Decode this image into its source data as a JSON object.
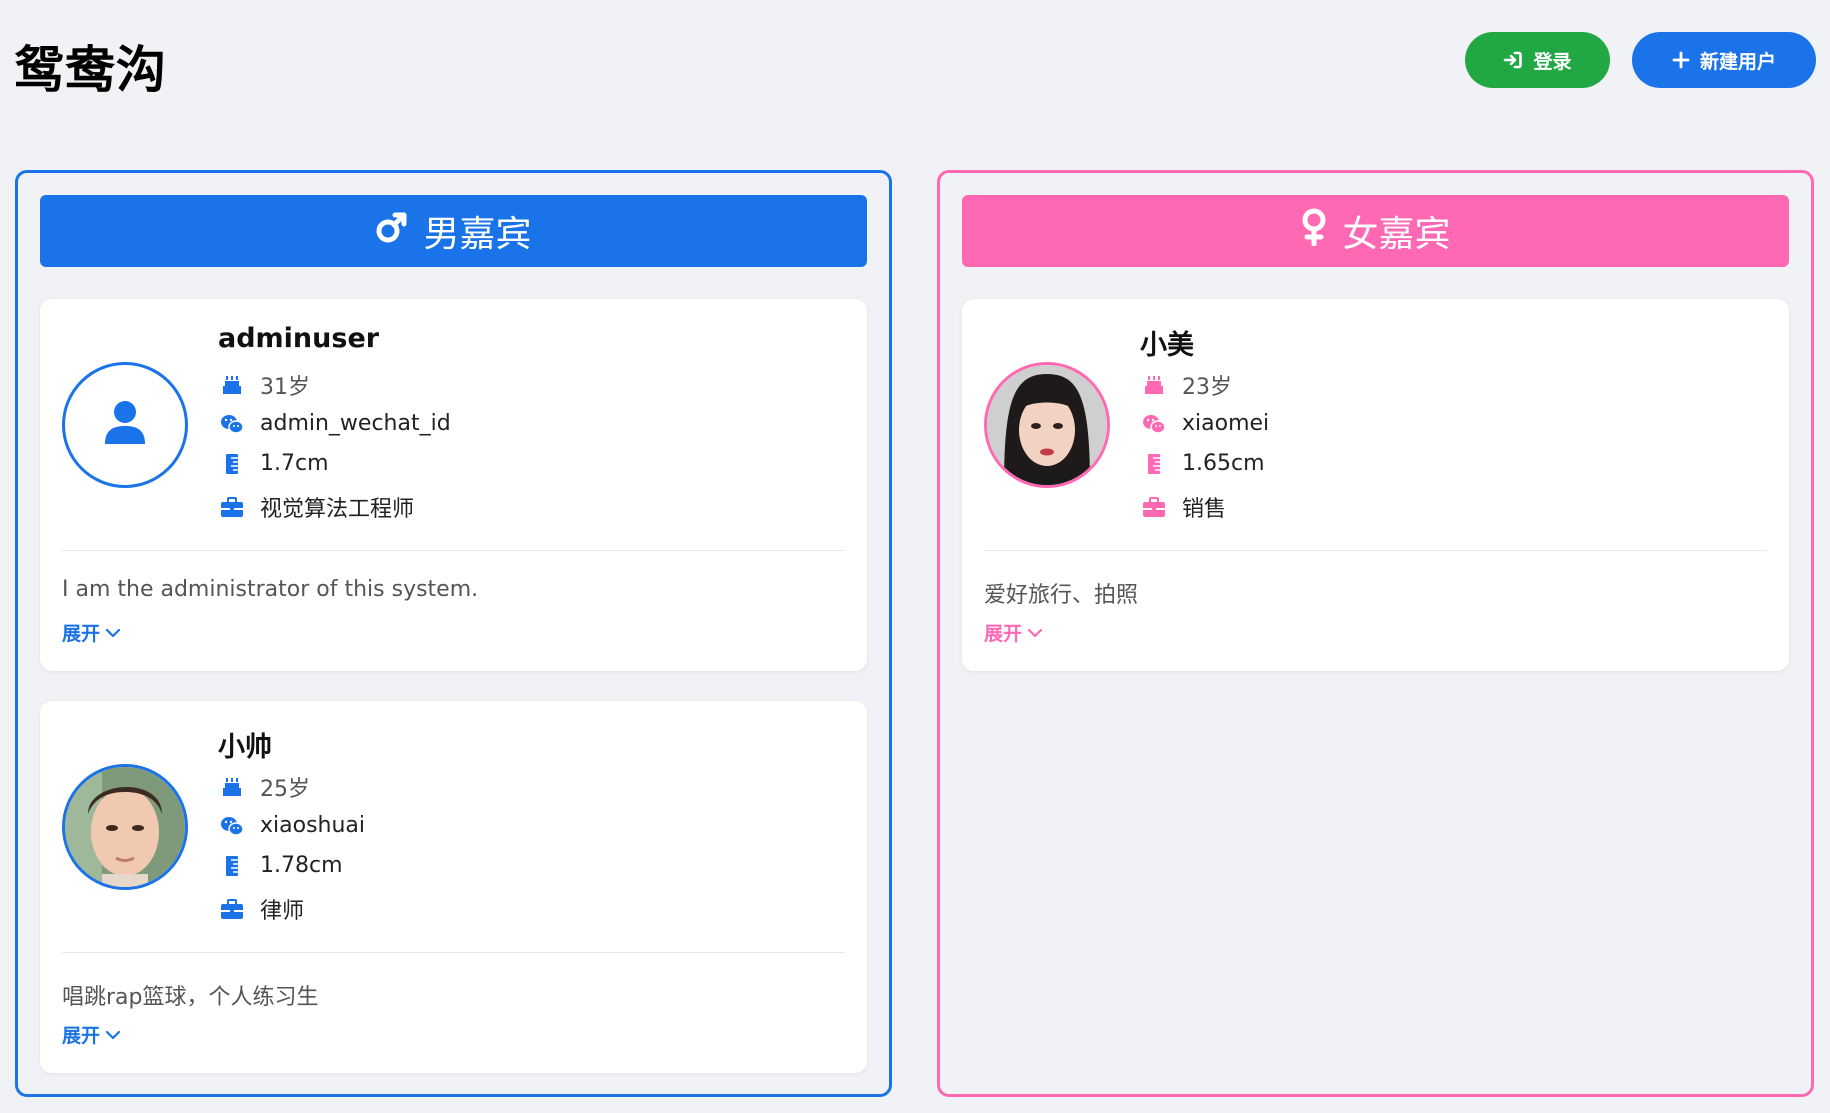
{
  "app": {
    "title": "鸳鸯沟"
  },
  "header": {
    "login_label": "登录",
    "new_user_label": "新建用户"
  },
  "colors": {
    "male_accent": "#1a73e8",
    "female_accent": "#ff69b4",
    "login_button": "#21a744",
    "background": "#f0f2f5"
  },
  "columns": {
    "male": {
      "title": "男嘉宾",
      "icon": "mars-icon",
      "cards": [
        {
          "name": "adminuser",
          "age": "31岁",
          "wechat": "admin_wechat_id",
          "height": "1.7cm",
          "job": "视觉算法工程师",
          "bio": "I am the administrator of this system.",
          "expand_label": "展开",
          "avatar": "default-user-icon"
        },
        {
          "name": "小帅",
          "age": "25岁",
          "wechat": "xiaoshuai",
          "height": "1.78cm",
          "job": "律师",
          "bio": "唱跳rap篮球，个人练习生",
          "expand_label": "展开",
          "avatar": "photo"
        }
      ]
    },
    "female": {
      "title": "女嘉宾",
      "icon": "venus-icon",
      "cards": [
        {
          "name": "小美",
          "age": "23岁",
          "wechat": "xiaomei",
          "height": "1.65cm",
          "job": "销售",
          "bio": "爱好旅行、拍照",
          "expand_label": "展开",
          "avatar": "photo"
        }
      ]
    }
  }
}
